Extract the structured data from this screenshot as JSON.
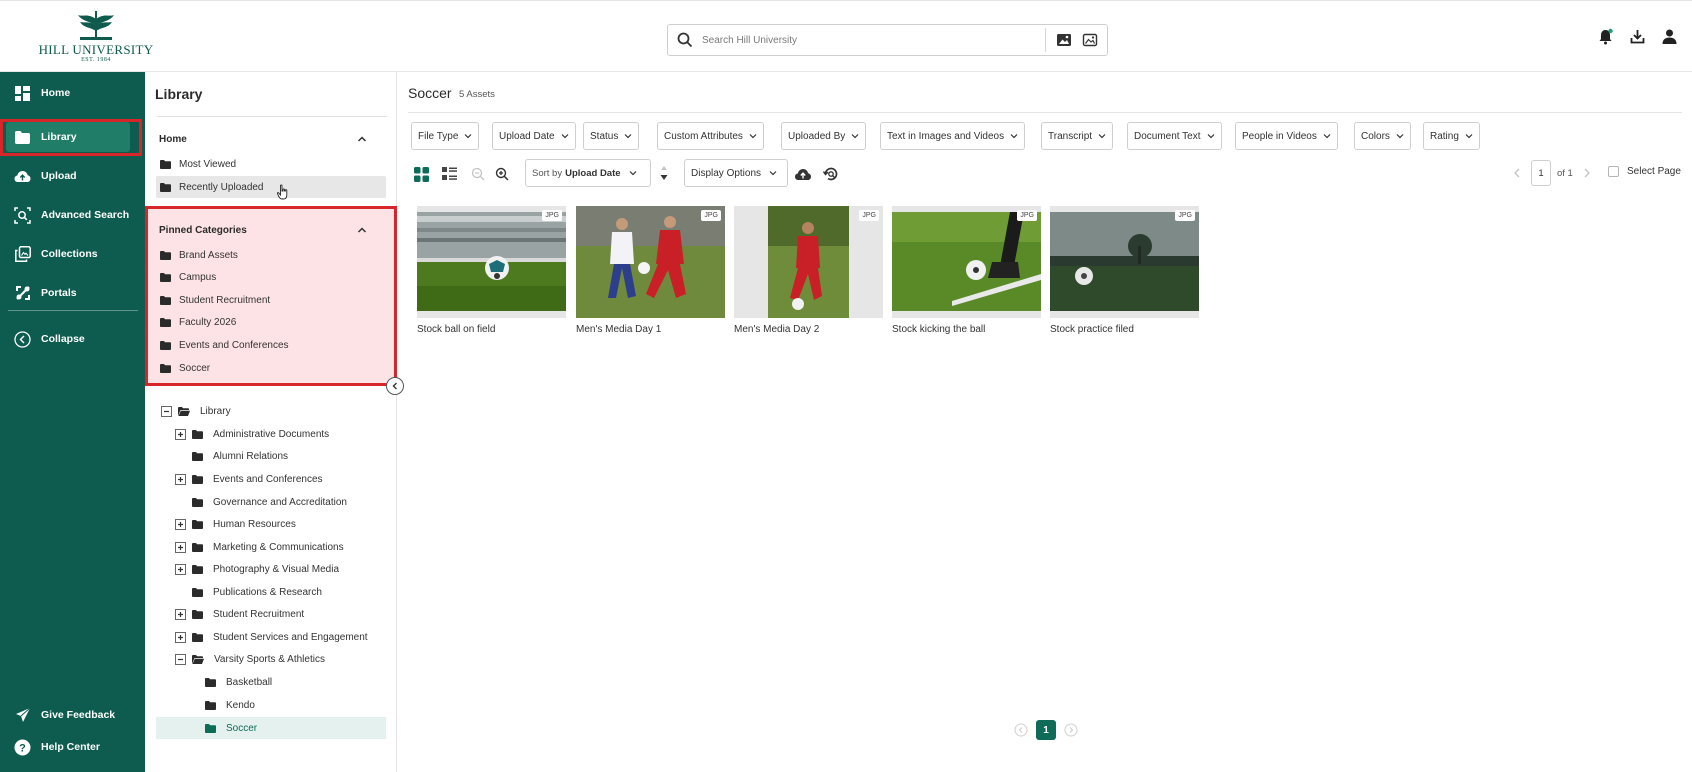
{
  "brand": {
    "name": "HILL UNIVERSITY",
    "est": "EST. 1984",
    "primary": "#0d5c4f",
    "accent": "#d6262a"
  },
  "search": {
    "placeholder": "Search Hill University"
  },
  "header_icons": [
    "bell-icon",
    "download-icon",
    "user-icon"
  ],
  "nav": {
    "items": [
      {
        "label": "Home",
        "icon": "dashboard-icon"
      },
      {
        "label": "Library",
        "icon": "folder-icon",
        "active": true
      },
      {
        "label": "Upload",
        "icon": "cloud-upload-icon"
      },
      {
        "label": "Advanced Search",
        "icon": "advanced-search-icon"
      },
      {
        "label": "Collections",
        "icon": "collections-icon"
      },
      {
        "label": "Portals",
        "icon": "portals-icon"
      },
      {
        "label": "Collapse",
        "icon": "collapse-icon"
      }
    ],
    "footer": [
      {
        "label": "Give Feedback",
        "icon": "send-icon"
      },
      {
        "label": "Help Center",
        "icon": "help-icon"
      }
    ]
  },
  "library_panel": {
    "title": "Library",
    "home_section": {
      "title": "Home",
      "items": [
        "Most Viewed",
        "Recently Uploaded"
      ]
    },
    "pinned_section": {
      "title": "Pinned Categories",
      "items": [
        "Brand Assets",
        "Campus",
        "Student Recruitment",
        "Faculty 2026",
        "Events and Conferences",
        "Soccer"
      ]
    },
    "tree": {
      "root": "Library",
      "items": [
        {
          "label": "Administrative Documents",
          "toggle": "plus"
        },
        {
          "label": "Alumni Relations",
          "toggle": "none"
        },
        {
          "label": "Events and Conferences",
          "toggle": "plus"
        },
        {
          "label": "Governance and Accreditation",
          "toggle": "none"
        },
        {
          "label": "Human Resources",
          "toggle": "plus"
        },
        {
          "label": "Marketing & Communications",
          "toggle": "plus"
        },
        {
          "label": "Photography & Visual Media",
          "toggle": "plus"
        },
        {
          "label": "Publications & Research",
          "toggle": "none"
        },
        {
          "label": "Student Recruitment",
          "toggle": "plus"
        },
        {
          "label": "Student Services and Engagement",
          "toggle": "plus"
        },
        {
          "label": "Varsity Sports & Athletics",
          "toggle": "minus"
        }
      ],
      "children": [
        "Basketball",
        "Kendo",
        "Soccer"
      ],
      "selected": "Soccer"
    }
  },
  "main": {
    "title": "Soccer",
    "count": "5 Assets",
    "filters": [
      "File Type",
      "Upload Date",
      "Status",
      "Custom Attributes",
      "Uploaded By",
      "Text in Images and Videos",
      "Transcript",
      "Document Text",
      "People in Videos",
      "Colors",
      "Rating"
    ],
    "sort": {
      "prefix": "Sort by",
      "value": "Upload Date"
    },
    "display_options": "Display Options",
    "pagination": {
      "current": "1",
      "of": "of 1"
    },
    "select_page": "Select Page",
    "assets": [
      {
        "name": "Stock ball on field",
        "type": "JPG"
      },
      {
        "name": "Men's Media Day 1",
        "type": "JPG"
      },
      {
        "name": "Men's Media Day 2",
        "type": "JPG"
      },
      {
        "name": "Stock kicking the ball",
        "type": "JPG"
      },
      {
        "name": "Stock practice filed",
        "type": "JPG"
      }
    ],
    "bottom_page": "1"
  }
}
